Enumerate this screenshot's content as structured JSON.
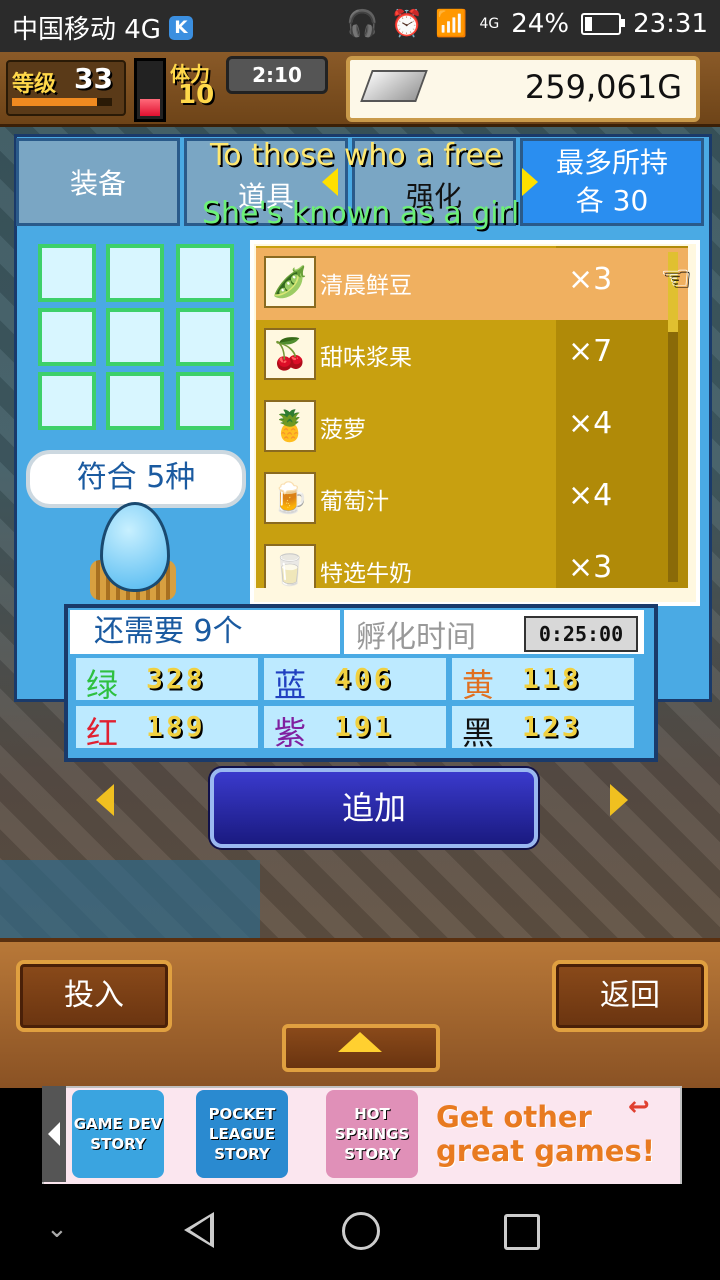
{
  "status_bar": {
    "carrier": "中国移动 4G",
    "carrier_badge": "K",
    "network": "4G",
    "battery": "24%",
    "battery_level": 0.24,
    "time": "23:31"
  },
  "hud": {
    "level_label": "等级",
    "level": "33",
    "level_progress": 0.85,
    "stamina_level": 0.3,
    "ticket_label": "体力",
    "ticket_count": "10",
    "timer": "2:10",
    "money": "259,061G"
  },
  "tabs": {
    "equip": "装备",
    "items": "道具",
    "enhance": "强化",
    "max_label": "最多所持",
    "max_each": "各 30"
  },
  "overlay": {
    "line1": "To those who a free",
    "line2": "She's known as a girl"
  },
  "match_badge": "符合 5种",
  "items": [
    {
      "name": "清晨鲜豆",
      "qty": "×3",
      "icon": "bean-icon",
      "glyph": "🫛"
    },
    {
      "name": "甜味浆果",
      "qty": "×7",
      "icon": "berry-icon",
      "glyph": "🍒"
    },
    {
      "name": "菠萝",
      "qty": "×4",
      "icon": "pineapple-icon",
      "glyph": "🍍"
    },
    {
      "name": "葡萄汁",
      "qty": "×4",
      "icon": "juice-icon",
      "glyph": "🍺"
    },
    {
      "name": "特选牛奶",
      "qty": "×3",
      "icon": "milk-icon",
      "glyph": "🥛"
    }
  ],
  "stats": {
    "needed": "还需要 9个",
    "hatch_label": "孵化时间",
    "hatch_time": "0:25:00",
    "colors": [
      {
        "label": "绿",
        "value": "328",
        "color": "#2ec040"
      },
      {
        "label": "蓝",
        "value": "406",
        "color": "#2040c0"
      },
      {
        "label": "黄",
        "value": "118",
        "color": "#e07020"
      },
      {
        "label": "红",
        "value": "189",
        "color": "#e02030"
      },
      {
        "label": "紫",
        "value": "191",
        "color": "#8020a0"
      },
      {
        "label": "黑",
        "value": "123",
        "color": "#111111"
      }
    ]
  },
  "add_button": "追加",
  "bottom": {
    "put_in": "投入",
    "back": "返回"
  },
  "ad": {
    "games": [
      {
        "line1": "GAME DEV",
        "line2": "STORY"
      },
      {
        "line1": "POCKET LEAGUE",
        "line2": "STORY"
      },
      {
        "line1": "HOT SPRINGS",
        "line2": "STORY"
      }
    ],
    "cta": "Get other great games!"
  }
}
